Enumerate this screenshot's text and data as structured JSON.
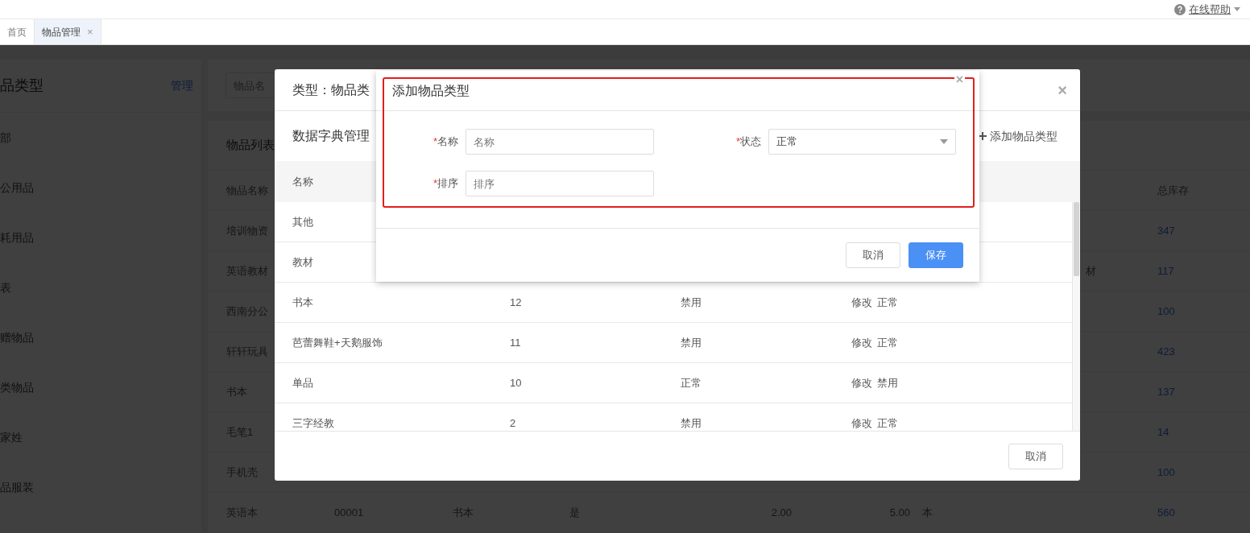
{
  "header": {
    "help_link": "在线帮助"
  },
  "tabs": [
    {
      "label": "首页",
      "selected": false
    },
    {
      "label": "物品管理",
      "selected": true,
      "close": "×"
    }
  ],
  "sidebar": {
    "title": "品类型",
    "action": "管理",
    "items": [
      {
        "label": "部"
      },
      {
        "label": "公用品"
      },
      {
        "label": "耗用品"
      },
      {
        "label": "表"
      },
      {
        "label": "赠物品"
      },
      {
        "label": "类物品"
      },
      {
        "label": "家姓"
      },
      {
        "label": "品服装"
      }
    ]
  },
  "search": {
    "placeholder": "物品名"
  },
  "item_list": {
    "title": "物品列表",
    "columns": {
      "name": "物品名称",
      "stock": "总库存"
    },
    "rows": [
      {
        "name": "培训物资",
        "stock": "347"
      },
      {
        "name": "英语教材",
        "type": "材",
        "stock": "117"
      },
      {
        "name": "西南分公",
        "stock": "100"
      },
      {
        "name": "轩轩玩具",
        "stock": "423"
      },
      {
        "name": "书本",
        "stock": "137"
      },
      {
        "name": "毛笔1",
        "stock": "14"
      },
      {
        "name": "手机壳",
        "stock": "100"
      },
      {
        "name": "英语本",
        "code": "00001",
        "category": "书本",
        "flag": "是",
        "price": "2.00",
        "sale_price": "5.00",
        "unit": "本",
        "stock": "560"
      }
    ]
  },
  "dictionary_dialog": {
    "title": "类型：物品类",
    "close": "×",
    "section_title": "数据字典管理",
    "add_button": "添加物品类型",
    "columns": [
      "名称"
    ],
    "rows": [
      {
        "name": "其他"
      },
      {
        "name": "教材"
      },
      {
        "name": "书本",
        "sort": "12",
        "status": "禁用",
        "actions": [
          "修改",
          "正常"
        ]
      },
      {
        "name": "芭蕾舞鞋+天鹅服饰",
        "sort": "11",
        "status": "禁用",
        "actions": [
          "修改",
          "正常"
        ]
      },
      {
        "name": "单品",
        "sort": "10",
        "status": "正常",
        "actions": [
          "修改",
          "禁用"
        ]
      },
      {
        "name": "三字经教",
        "sort": "2",
        "status": "禁用",
        "actions": [
          "修改",
          "正常"
        ]
      }
    ],
    "footer_buttons": [
      "取消"
    ]
  },
  "add_dialog": {
    "title": "添加物品类型",
    "close": "×",
    "fields": [
      {
        "kind": "input",
        "required_mark": "*",
        "label": "名称",
        "placeholder": "名称"
      },
      {
        "kind": "select",
        "required_mark": "*",
        "label": "状态",
        "value": "正常"
      },
      {
        "kind": "input",
        "required_mark": "*",
        "label": "排序",
        "placeholder": "排序"
      }
    ],
    "buttons": [
      {
        "label": "取消",
        "primary": false
      },
      {
        "label": "保存",
        "primary": true
      }
    ]
  }
}
